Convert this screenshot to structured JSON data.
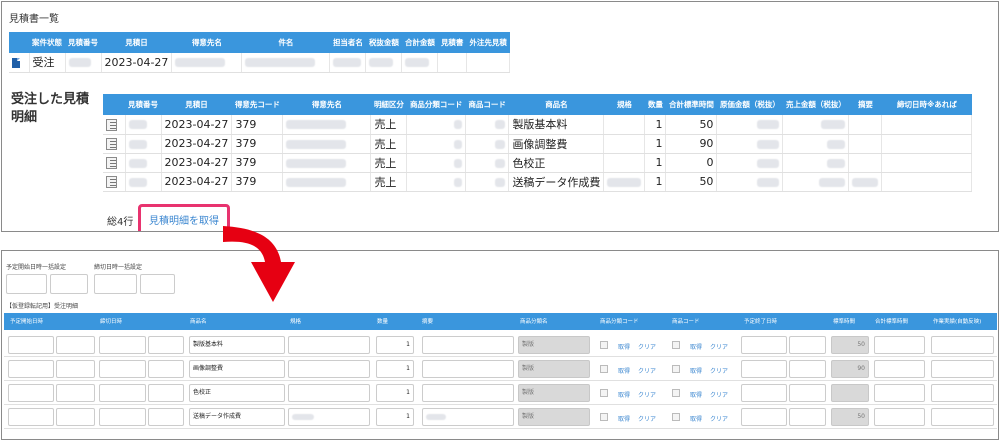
{
  "top": {
    "section_title": "見積書一覧",
    "list_headers": [
      "案件状態",
      "見積番号",
      "見積日",
      "得意先名",
      "件名",
      "担当者名",
      "税抜金額",
      "合計金額",
      "見積書",
      "外注先見積"
    ],
    "list_row": {
      "status": "受注",
      "date": "2023-04-27"
    },
    "side_title": "受注した見積明細",
    "detail_headers": [
      "",
      "見積番号",
      "見積日",
      "得意先コード",
      "得意先名",
      "明細区分",
      "商品分類コード",
      "商品コード",
      "商品名",
      "規格",
      "数量",
      "合計標準時間",
      "原価金額（税抜）",
      "売上金額（税抜）",
      "摘要",
      "締切日時※あれば"
    ],
    "detail_rows": [
      {
        "date": "2023-04-27",
        "code": "379",
        "kubun": "売上",
        "product": "製版基本料",
        "qty": "1",
        "time": "50"
      },
      {
        "date": "2023-04-27",
        "code": "379",
        "kubun": "売上",
        "product": "画像調整費",
        "qty": "1",
        "time": "90"
      },
      {
        "date": "2023-04-27",
        "code": "379",
        "kubun": "売上",
        "product": "色校正",
        "qty": "1",
        "time": "0"
      },
      {
        "date": "2023-04-27",
        "code": "379",
        "kubun": "売上",
        "product": "送稿データ作成費",
        "qty": "1",
        "time": "50"
      }
    ],
    "total_label": "総4行",
    "fetch_button": "見積明細を取得"
  },
  "bottom": {
    "label_start_bulk": "予定開始日時一括設定",
    "label_deadline_bulk": "締切日時一括設定",
    "label_section": "【仮登録転記用】受注明細",
    "headers": [
      "予定開始日時",
      "締切日時",
      "商品名",
      "規格",
      "数量",
      "摘要",
      "商品分類名",
      "商品分類コード",
      "商品コード",
      "予定終了日時",
      "標準時間",
      "合計標準時間",
      "作業実績(自動反映)"
    ],
    "rows": [
      {
        "product": "製版基本料",
        "qty": "1",
        "category": "製版",
        "time": "50"
      },
      {
        "product": "画像調整費",
        "qty": "1",
        "category": "製版",
        "time": "90"
      },
      {
        "product": "色校正",
        "qty": "1",
        "category": "製版",
        "time": ""
      },
      {
        "product": "送稿データ作成費",
        "qty": "1",
        "category": "製版",
        "time": "50"
      }
    ],
    "link_get": "取得",
    "link_clear": "クリア"
  },
  "colors": {
    "header_blue": "#3a96dd",
    "highlight": "#e8336f",
    "arrow": "#e60012",
    "link": "#3a86d0"
  }
}
